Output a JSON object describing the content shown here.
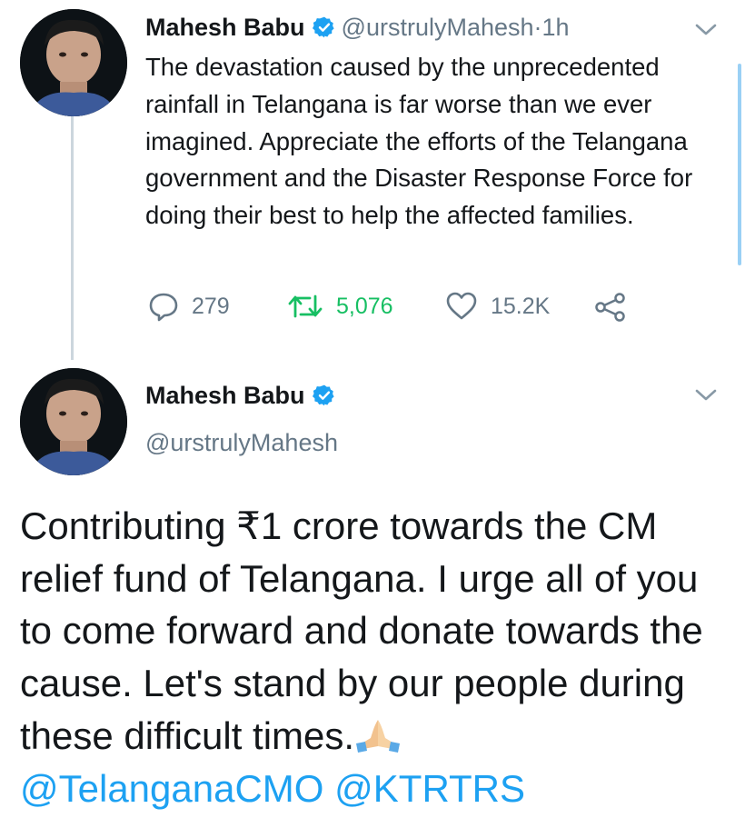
{
  "tweet1": {
    "author_name": "Mahesh Babu",
    "handle": "@urstrulyMahesh",
    "separator": " · ",
    "time": "1h",
    "text": "The devastation caused by the unprecedented rainfall in Telangana is far worse than we ever imagined. Appreciate the efforts of the Telangana government and the Disaster Response Force for doing their best to help the affected families.",
    "replies": "279",
    "retweets": "5,076",
    "likes": "15.2K"
  },
  "tweet2": {
    "author_name": "Mahesh Babu",
    "handle": "@urstrulyMahesh",
    "text": "Contributing ₹1 crore towards the CM relief fund of Telangana. I urge all of you to come forward and donate towards the cause. Let's stand by our people during these difficult times.",
    "mention1": "@TelanganaCMO",
    "mention2": "@KTRTRS"
  },
  "icons": {
    "verified": "verified-badge-icon",
    "more": "chevron-down-icon",
    "reply": "reply-icon",
    "retweet": "retweet-icon",
    "like": "heart-icon",
    "share": "share-icon",
    "emoji": "folded-hands-emoji"
  },
  "colors": {
    "text": "#14171a",
    "secondary": "#657786",
    "accent": "#1da1f2",
    "retweet": "#17bf63"
  }
}
